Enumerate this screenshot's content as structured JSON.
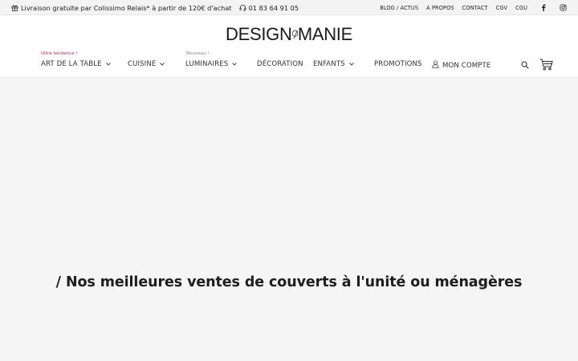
{
  "topbar": {
    "shipping_text": "Livraison gratuite par Colissimo Relais* à partir de 120€ d'achat",
    "phone": "01 83 64 91 05",
    "links": [
      "BLOG / ACTUS",
      "A PROPOS",
      "CONTACT",
      "CGV",
      "CGU"
    ],
    "icons": {
      "gift": "gift-icon",
      "headset": "headset-icon",
      "facebook": "facebook-icon",
      "instagram": "instagram-icon"
    }
  },
  "header": {
    "logo_text_left": "DESIGN",
    "logo_text_right": "MANIE"
  },
  "nav": {
    "items": [
      {
        "label": "ART DE LA TABLE",
        "tag": "Ultra tendance !",
        "has_dropdown": true
      },
      {
        "label": "CUISINE",
        "tag": "",
        "has_dropdown": true
      },
      {
        "label": "LUMINAIRES",
        "tag": "Nouveau !",
        "has_dropdown": true
      },
      {
        "label": "DÉCORATION",
        "tag": "",
        "has_dropdown": false
      },
      {
        "label": "ENFANTS",
        "tag": "",
        "has_dropdown": true
      },
      {
        "label": "PROMOTIONS",
        "tag": "",
        "has_dropdown": false
      },
      {
        "label": "MON COMPTE",
        "tag": "",
        "has_dropdown": false
      }
    ],
    "icons": {
      "account": "user-icon",
      "search": "search-icon",
      "cart": "cart-icon"
    }
  },
  "main": {
    "heading": "/ Nos meilleures ventes de couverts à l'unité ou ménagères"
  },
  "colors": {
    "accent_pink": "#c8245a",
    "background": "#f5f5f5",
    "header_bg": "#ffffff",
    "topbar_bg": "#f3f3f3"
  }
}
